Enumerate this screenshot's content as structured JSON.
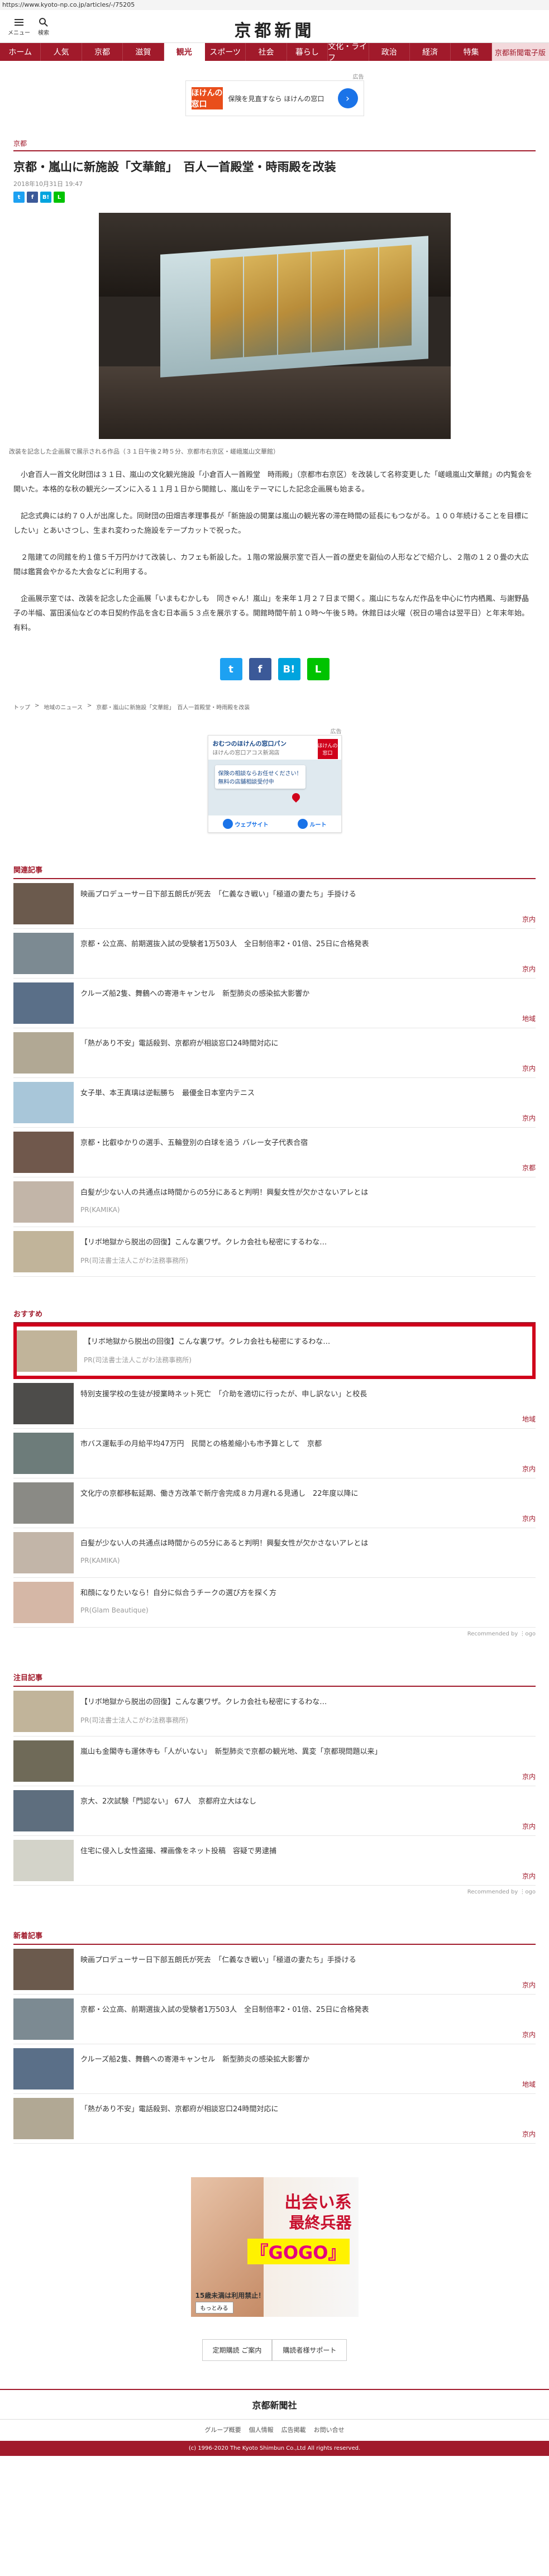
{
  "browser": {
    "url": "https://www.kyoto-np.co.jp/articles/-/75205"
  },
  "header": {
    "menu_label": "メニュー",
    "search_label": "検索",
    "logo": "京都新聞"
  },
  "nav": {
    "items": [
      "ホーム",
      "人気",
      "京都",
      "滋賀",
      "観光",
      "スポーツ",
      "社会",
      "暮らし",
      "文化・ライフ",
      "政治",
      "経済",
      "特集"
    ],
    "active_index": 4,
    "cta": "京都新聞電子版"
  },
  "top_ad": {
    "tag": "広告",
    "logo": "ほけんの窓口",
    "text": "保険を見直すなら ほけんの窓口"
  },
  "article": {
    "category": "京都",
    "title": "京都・嵐山に新施設「文華館」　百人一首殿堂・時雨殿を改装",
    "date": "2018年10月31日 19:47",
    "caption": "改装を記念した企画展で展示される作品（３１日午後２時５分、京都市右京区・嵯峨嵐山文華館）",
    "paragraphs": [
      "小倉百人一首文化財団は３１日、嵐山の文化観光施設「小倉百人一首殿堂　時雨殿」（京都市右京区）を改装して名称変更した「嵯峨嵐山文華館」の内覧会を開いた。本格的な秋の観光シーズンに入る１１月１日から開館し、嵐山をテーマにした記念企画展も始まる。",
      "記念式典には約７０人が出席した。同財団の田畑吉孝理事長が「新施設の開業は嵐山の観光客の滞在時間の延長にもつながる。１００年続けることを目標にしたい」とあいさつし、生まれ変わった施設をテープカットで祝った。",
      "２階建ての同館を約１億５千万円かけて改装し、カフェも新設した。１階の常設展示室で百人一首の歴史を副仙の人形などで紹介し、２階の１２０畳の大広間は鑑賞会やかるた大会などに利用する。",
      "企画展示室では、改装を記念した企画展「いまもむかしも　同きゃん！嵐山」を来年１月２７日まで開く。嵐山にちなんだ作品を中心に竹内栖鳳、与謝野晶子の半幅、冨田溪仙などの本日契約作品を含む日本画５３点を展示する。開館時間午前１０時～午後５時。休館日は火曜（祝日の場合は翌平日）と年末年始。有料。"
    ],
    "share": {
      "twitter": "t",
      "facebook": "f",
      "hatena": "B!",
      "line": "L"
    },
    "breadcrumb": [
      "トップ",
      "地域のニュース",
      "京都・嵐山に新施設「文華館」　百人一首殿堂・時雨殿を改装"
    ]
  },
  "map_ad": {
    "tag": "広告",
    "name": "おむつのほけんの窓口パン",
    "sub": "ほけんの窓口アコス新潟店",
    "badge": "ほけんの窓口",
    "bubble": "保険の相談ならお任せください！無料の店舗相談受付中",
    "btn_web": "ウェブサイト",
    "btn_route": "ルート"
  },
  "related": {
    "title": "関連記事",
    "items": [
      {
        "text": "映画プロデューサー日下部五朗氏が死去　「仁義なき戦い」「極道の妻たち」手掛ける",
        "cat": "京内",
        "color": "#6b5a4d"
      },
      {
        "text": "京都・公立高、前期選抜入試の受験者1万503人　全日制倍率2・01倍、25日に合格発表",
        "cat": "京内",
        "color": "#7c8a92"
      },
      {
        "text": "クルーズ船2隻、舞鶴への寄港キャンセル　新型肺炎の感染拡大影響か",
        "cat": "地域",
        "color": "#5a6f88"
      },
      {
        "text": "「熱があり不安」電話殺到、京都府が相談窓口24時間対応に",
        "cat": "京内",
        "color": "#b1a894"
      },
      {
        "text": "女子単、本王真璃は逆転勝ち　最優金日本室内テニス",
        "cat": "京内",
        "color": "#a8c6d9"
      },
      {
        "text": "京都・比叡ゆかりの選手、五輪登別の白球を追う バレー女子代表合宿",
        "cat": "京都",
        "color": "#70584c"
      },
      {
        "text": "白髪が少ない人の共通点は時間からの5分にあると判明！興髪女性が欠かさないアレとは",
        "cat": "PR(KAMIKA)",
        "color": "#c2b5a8",
        "pr": true
      },
      {
        "text": "【リボ地獄から脱出の回復】こんな裏ワザ。クレカ会社も秘密にするわな…",
        "cat": "PR(司法書士法人こがわ法務事務所)",
        "color": "#c1b49a",
        "pr": true
      }
    ]
  },
  "recommend": {
    "title": "おすすめ",
    "items": [
      {
        "text": "【リボ地獄から脱出の回復】こんな裏ワザ。クレカ会社も秘密にするわな…",
        "cat": "PR(司法書士法人こがわ法務事務所)",
        "color": "#c1b49a",
        "pr": true,
        "highlight": true
      },
      {
        "text": "特別支援学校の生徒が授業時ネット死亡　「介助を適切に行ったが、申し訳ない」と校長",
        "cat": "地域",
        "color": "#4d4c4a"
      },
      {
        "text": "市バス運転手の月給平均47万円　民間との格差縮小も市予算として　京都",
        "cat": "京内",
        "color": "#6d7c7a"
      },
      {
        "text": "文化庁の京都移転延期、働き方改革で新庁舎完成８カ月遅れる見通し　22年度以降に",
        "cat": "京内",
        "color": "#8a8a85"
      },
      {
        "text": "白髪が少ない人の共通点は時間からの5分にあると判明！興髪女性が欠かさないアレとは",
        "cat": "PR(KAMIKA)",
        "color": "#c2b5a8",
        "pr": true
      },
      {
        "text": "和顔になりたいなら！自分に似合うチークの選び方を探く方",
        "cat": "PR(Glam Beautique)",
        "color": "#d5b7a6",
        "pr": true
      }
    ],
    "byline": "Recommended by ⋮ogo"
  },
  "attention": {
    "title": "注目記事",
    "items": [
      {
        "text": "【リボ地獄から脱出の回復】こんな裏ワザ。クレカ会社も秘密にするわな…",
        "cat": "PR(司法書士法人こがわ法務事務所)",
        "color": "#c1b49a",
        "pr": true
      },
      {
        "text": "嵐山も金閣寺も運休寺も「人がいない」　新型肺炎で京都の観光地、異変「京都現問題以来」",
        "cat": "京内",
        "color": "#6f6a58"
      },
      {
        "text": "京大、2次試験「門認ない」 67人　京都府立大はなし",
        "cat": "京内",
        "color": "#5e6e7e"
      },
      {
        "text": "住宅に侵入し女性盗撮、裸画像をネット投稿　容疑で男逮捕",
        "cat": "京内",
        "color": "#d3d3c9"
      }
    ],
    "byline": "Recommended by ⋮ogo"
  },
  "latest": {
    "title": "新着記事",
    "items": [
      {
        "text": "映画プロデューサー日下部五朗氏が死去　「仁義なき戦い」「極道の妻たち」手掛ける",
        "cat": "京内",
        "color": "#6b5a4d"
      },
      {
        "text": "京都・公立高、前期選抜入試の受験者1万503人　全日制倍率2・01倍、25日に合格発表",
        "cat": "京内",
        "color": "#7c8a92"
      },
      {
        "text": "クルーズ船2隻、舞鶴への寄港キャンセル　新型肺炎の感染拡大影響か",
        "cat": "地域",
        "color": "#5a6f88"
      },
      {
        "text": "「熱があり不安」電話殺到、京都府が相談窓口24時間対応に",
        "cat": "京内",
        "color": "#b1a894"
      }
    ]
  },
  "bottom_ad": {
    "line1": "出会い系",
    "line2": "最終兵器",
    "line3": "『GOGO』",
    "foot": "15歳未満は利用禁止！",
    "button": "もっとみる"
  },
  "footer": {
    "links": [
      "定期購読 ご案内",
      "購読者様サポート"
    ],
    "logo": "京都新聞社",
    "menu": [
      "グループ概要",
      "個人情報",
      "広告掲載",
      "お問い合せ"
    ],
    "copyright": "(c) 1996-2020 The Kyoto Shimbun Co.,Ltd All rights reserved."
  },
  "colors": {
    "brand": "#a11a2b",
    "highlight": "#d0021b"
  }
}
